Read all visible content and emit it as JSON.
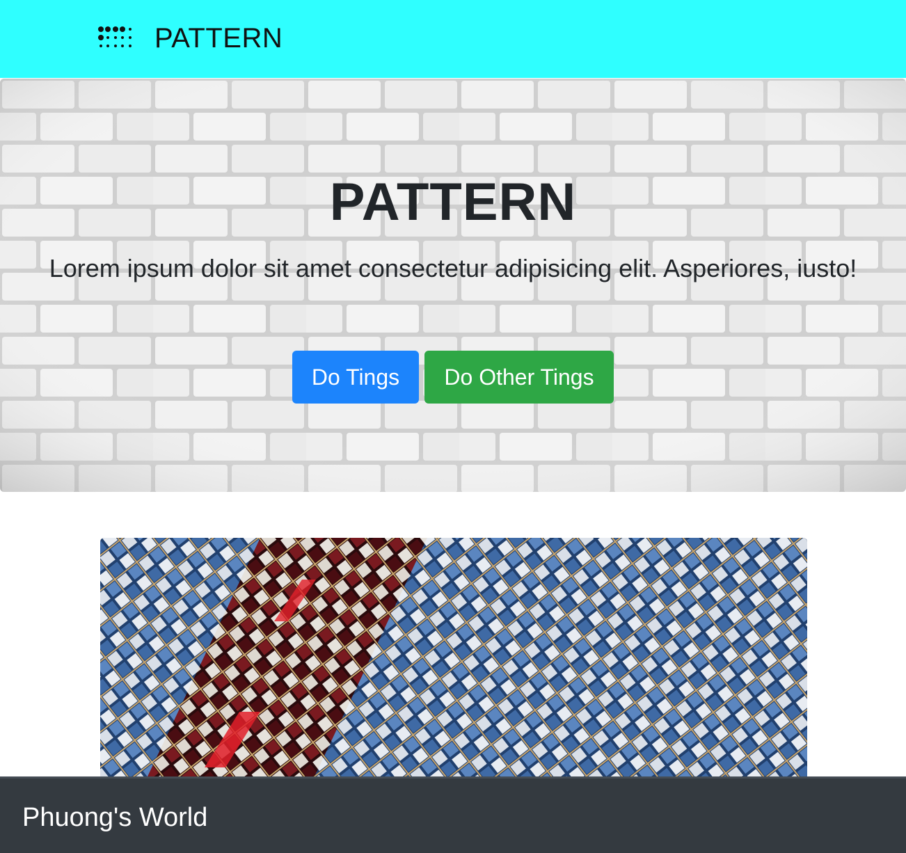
{
  "navbar": {
    "brand_icon": "braille-dots-icon",
    "brand_label": "PATTERN",
    "background_color": "#2fffff"
  },
  "hero": {
    "background": "white-brick-wall",
    "title": "PATTERN",
    "lead": "Lorem ipsum dolor sit amet consectetur adipisicing elit. Asperiores, iusto!",
    "buttons": {
      "primary_label": "Do Tings",
      "secondary_label": "Do Other Tings"
    }
  },
  "colors": {
    "primary": "#1c84fc",
    "success": "#2ea745",
    "footer_bg": "#343a40"
  },
  "main": {
    "image": "building-facade-windows-pattern"
  },
  "footer": {
    "text": "Phuong's World"
  }
}
